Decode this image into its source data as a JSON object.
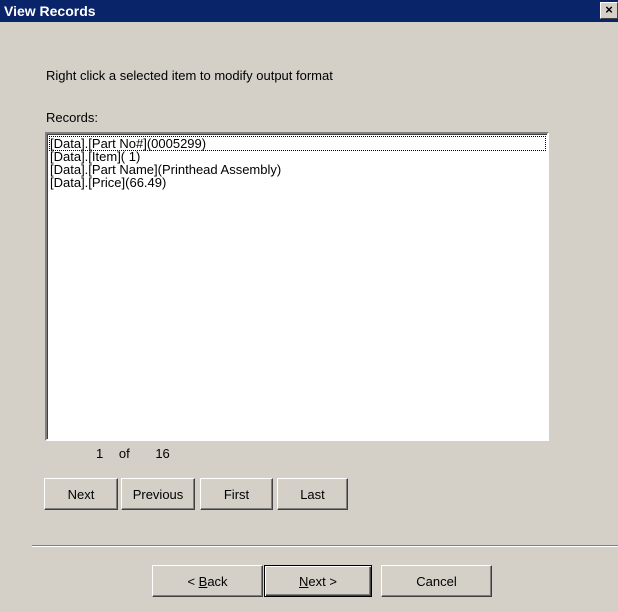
{
  "window": {
    "title": "View Records",
    "close_glyph": "×"
  },
  "instruction": "Right click a selected item to modify output format",
  "records_label": "Records:",
  "records": [
    "[Data].[Part No#](0005299)",
    "[Data].[Item]( 1)",
    "[Data].[Part Name](Printhead Assembly)",
    "[Data].[Price](66.49)"
  ],
  "pager": {
    "current": "1",
    "of": "of",
    "total": "16"
  },
  "nav_buttons": {
    "next": "Next",
    "previous": "Previous",
    "first": "First",
    "last": "Last"
  },
  "wizard_buttons": {
    "back_prefix": "< ",
    "back_key": "B",
    "back_rest": "ack",
    "next_key": "N",
    "next_rest": "ext >",
    "cancel": "Cancel"
  }
}
